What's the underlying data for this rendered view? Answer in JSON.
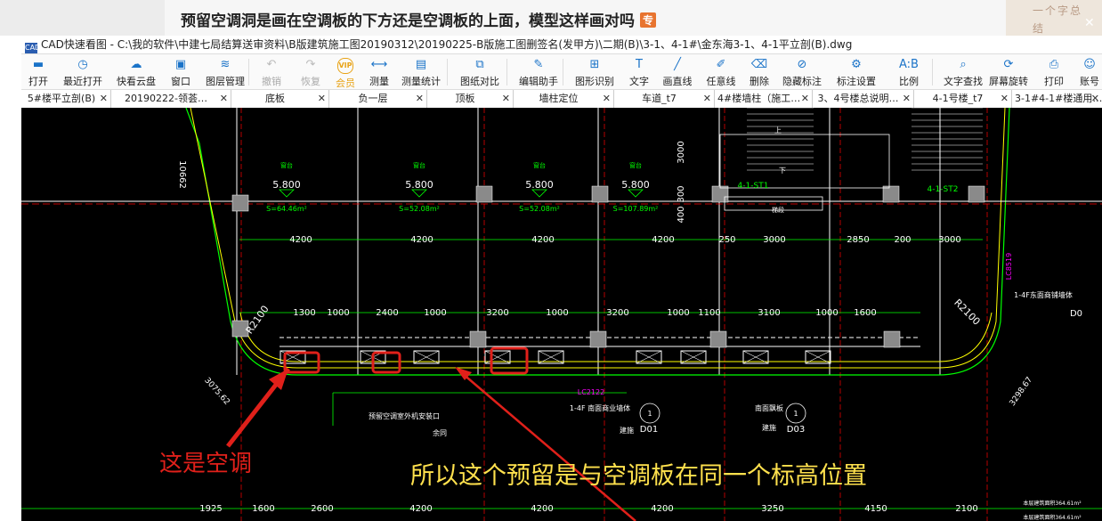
{
  "post": {
    "title": "预留空调洞是画在空调板的下方还是空调板的上面，模型这样画对吗",
    "tag": "专",
    "side_text": "一个字总结"
  },
  "window": {
    "app_icon": "CAD",
    "title": "CAD快速看图 - C:\\我的软件\\中建七局结算送审资料\\B版建筑施工图20190312\\20190225-B版施工图删签名(发甲方)\\二期(B)\\3-1、4-1#\\金东海3-1、4-1平立剖(B).dwg"
  },
  "toolbar": [
    {
      "label": "打开",
      "icon": "folder-icon",
      "glyph": "▬"
    },
    {
      "label": "最近打开",
      "icon": "clock-icon",
      "glyph": "◷"
    },
    {
      "label": "快看云盘",
      "icon": "cloud-icon",
      "glyph": "☁"
    },
    {
      "label": "窗口",
      "icon": "window-icon",
      "glyph": "▣"
    },
    {
      "label": "图层管理",
      "icon": "layers-icon",
      "glyph": "≋"
    },
    {
      "label": "撤销",
      "icon": "undo-icon",
      "glyph": "↶",
      "disabled": true
    },
    {
      "label": "恢复",
      "icon": "redo-icon",
      "glyph": "↷",
      "disabled": true
    },
    {
      "label": "会员",
      "icon": "vip-icon",
      "glyph": "VIP",
      "vip": true
    },
    {
      "label": "测量",
      "icon": "ruler-icon",
      "glyph": "⟷"
    },
    {
      "label": "测量统计",
      "icon": "stats-icon",
      "glyph": "▤"
    },
    {
      "label": "图纸对比",
      "icon": "compare-icon",
      "glyph": "⧉"
    },
    {
      "label": "编辑助手",
      "icon": "edit-assistant-icon",
      "glyph": "✎"
    },
    {
      "label": "图形识别",
      "icon": "recognize-icon",
      "glyph": "⊞"
    },
    {
      "label": "文字",
      "icon": "text-icon",
      "glyph": "T"
    },
    {
      "label": "画直线",
      "icon": "line-icon",
      "glyph": "╱"
    },
    {
      "label": "任意线",
      "icon": "pen-icon",
      "glyph": "✐"
    },
    {
      "label": "删除",
      "icon": "eraser-icon",
      "glyph": "⌫"
    },
    {
      "label": "隐藏标注",
      "icon": "hide-icon",
      "glyph": "⊘"
    },
    {
      "label": "标注设置",
      "icon": "settings-icon",
      "glyph": "⚙"
    },
    {
      "label": "比例",
      "icon": "scale-icon",
      "glyph": "A:B"
    },
    {
      "label": "文字查找",
      "icon": "search-icon",
      "glyph": "⌕"
    },
    {
      "label": "屏幕旋转",
      "icon": "rotate-icon",
      "glyph": "⟳"
    },
    {
      "label": "打印",
      "icon": "print-icon",
      "glyph": "⎙"
    },
    {
      "label": "账号",
      "icon": "user-icon",
      "glyph": "☺"
    }
  ],
  "tabs": [
    "5#楼平立剖(B)",
    "20190222-领荟…",
    "底板",
    "负一层",
    "顶板",
    "墙柱定位",
    "车道_t7",
    "4#楼墙柱（施工…",
    "3、4号楼总说明…",
    "4-1号楼_t7",
    "3-1#4-1#楼通用…"
  ],
  "drawing": {
    "elev_label": "窗台",
    "elevations": [
      "5.800",
      "5.800",
      "5.800",
      "5.800"
    ],
    "areas": [
      "S=64.46m²",
      "S=52.08m²",
      "S=52.08m²",
      "S=107.89m²"
    ],
    "dim_top": [
      "4200",
      "4200",
      "4200",
      "4200",
      "250",
      "3000",
      "2850",
      "200",
      "3000"
    ],
    "dim_mid": [
      "1300",
      "1000",
      "2400",
      "1000",
      "3200",
      "1000",
      "3200",
      "1000",
      "1100",
      "3100",
      "1000",
      "1600"
    ],
    "dim_bottom": [
      "1925",
      "1600",
      "2600",
      "4200",
      "4200",
      "4200",
      "3250",
      "4150",
      "2100"
    ],
    "vert_dims": [
      "10662",
      "3000",
      "300",
      "400"
    ],
    "radius_left": "R2100",
    "radius_right": "R2100",
    "dim_diag_left": "3075.62",
    "dim_diag_right": "3298.67",
    "stair_left": "4-1-ST1",
    "stair_right": "4-1-ST2",
    "stair_note_up": "上",
    "stair_note_down": "下",
    "stair_label": "梯段",
    "note_ac": "预留空调室外机安装口",
    "note_ac2": "余同",
    "lc_tag": "LC2122",
    "lc_tag_right": "LC8519",
    "shop_note": "1-4F 南面商业墙体",
    "shop_note2": "南面飘板",
    "shop_note3": "建施",
    "shop_note4": "建施",
    "callout_d01": "D01",
    "callout_d03": "D03",
    "callout_1": "1",
    "callout_1b": "1",
    "right_note": "1-4F东面商铺墙体",
    "right_callout": "D0",
    "bottom_note1": "本层建筑面积364.61m²",
    "bottom_note2": "本层建筑面积364.61m²",
    "annotation_ac": "这是空调",
    "annotation_level": "所以这个预留是与空调板在同一个标高位置"
  },
  "colors": {
    "canvas_bg": "#000000",
    "cad_green": "#00ff00",
    "cad_white": "#ffffff",
    "cad_yellow": "#ffff00",
    "cad_cyan": "#00ffff",
    "cad_magenta": "#ff00ff",
    "cad_red": "#ff0000",
    "highlight_red": "#e0201a",
    "annotation_yellow": "#ffe14d",
    "vip_orange": "#e8a317",
    "post_tag": "#e8742f"
  }
}
